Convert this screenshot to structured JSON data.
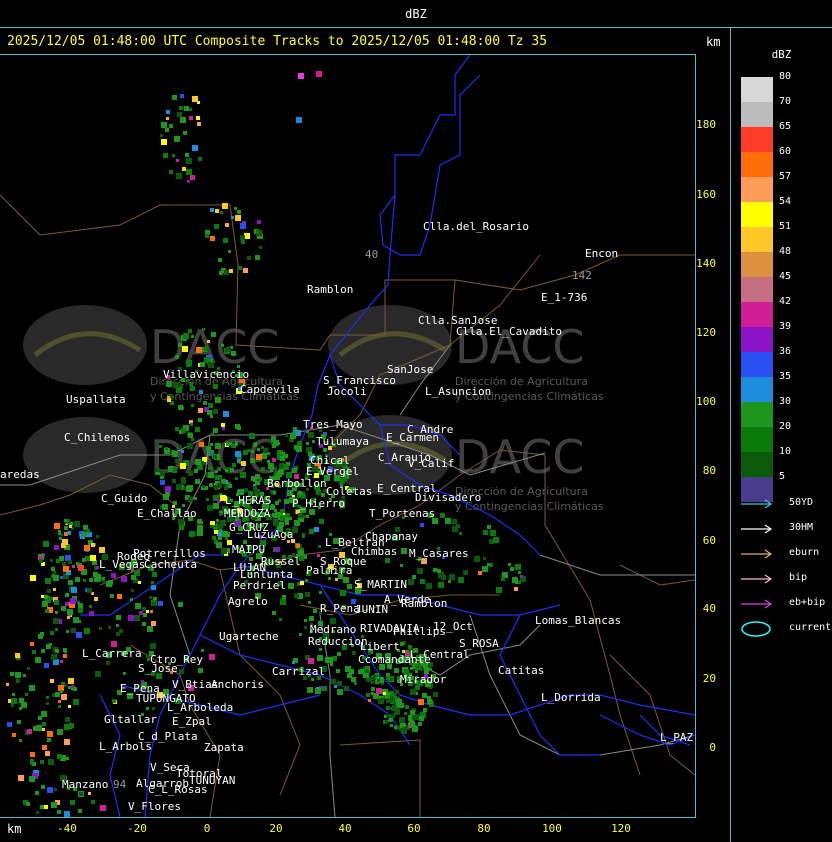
{
  "window": {
    "title": "dBZ"
  },
  "header": {
    "text": "2025/12/05 01:48:00 UTC Composite Tracks to 2025/12/05 01:48:00 Tz 35",
    "km_label": "km"
  },
  "axes": {
    "x_label": "km",
    "y_ticks": [
      "180",
      "160",
      "140",
      "120",
      "100",
      "80",
      "60",
      "40",
      "20",
      "0"
    ],
    "x_ticks": [
      "-40",
      "-20",
      "0",
      "20",
      "40",
      "60",
      "80",
      "100",
      "120"
    ]
  },
  "legend": {
    "title": "dBZ",
    "scale": [
      {
        "label": "80",
        "color": "#d8d8d8"
      },
      {
        "label": "70",
        "color": "#bcbcbc"
      },
      {
        "label": "65",
        "color": "#ff3c28"
      },
      {
        "label": "60",
        "color": "#ff6e0a"
      },
      {
        "label": "57",
        "color": "#ff9c5a"
      },
      {
        "label": "54",
        "color": "#ffff00"
      },
      {
        "label": "51",
        "color": "#ffc828"
      },
      {
        "label": "48",
        "color": "#dc9040"
      },
      {
        "label": "45",
        "color": "#c86e82"
      },
      {
        "label": "42",
        "color": "#d01e96"
      },
      {
        "label": "39",
        "color": "#8c14c8"
      },
      {
        "label": "36",
        "color": "#2850f0"
      },
      {
        "label": "35",
        "color": "#1e8cdc"
      },
      {
        "label": "30",
        "color": "#1e961e"
      },
      {
        "label": "20",
        "color": "#0a7a0a"
      },
      {
        "label": "10",
        "color": "#0a5a0a"
      },
      {
        "label": "5",
        "color": "#4a3c8c"
      }
    ],
    "tracks": [
      {
        "label": "50YD",
        "color": "#40c8d8",
        "kind": "arrow"
      },
      {
        "label": "30HM",
        "color": "#ffffff",
        "kind": "arrow"
      },
      {
        "label": "eburn",
        "color": "#e0b070",
        "kind": "arrow"
      },
      {
        "label": "bip",
        "color": "#ffb8d0",
        "kind": "arrow"
      },
      {
        "label": "eb+bip",
        "color": "#e040e0",
        "kind": "arrow"
      },
      {
        "label": "current",
        "color": "#30f0f0",
        "kind": "ellipse"
      }
    ]
  },
  "watermarks": [
    {
      "name": "DACC",
      "line1": "Dirección de Agricultura",
      "line2": "y Contingencias Climáticas"
    }
  ],
  "places": [
    {
      "name": "Clla.del_Rosario"
    },
    {
      "name": "Encon"
    },
    {
      "name": "142"
    },
    {
      "name": "E_1-736"
    },
    {
      "name": "Ramblon"
    },
    {
      "name": "40"
    },
    {
      "name": "Clla.SanJose"
    },
    {
      "name": "Clla.El_Cavadito"
    },
    {
      "name": "Villavicencio"
    },
    {
      "name": "Capdevila"
    },
    {
      "name": "S_Francisco"
    },
    {
      "name": "Jocoli"
    },
    {
      "name": "SanJose"
    },
    {
      "name": "L_Asuncion"
    },
    {
      "name": "Uspallata"
    },
    {
      "name": "Tres_Mayo"
    },
    {
      "name": "C_Andre"
    },
    {
      "name": "C_Chilenos"
    },
    {
      "name": "Tulumaya"
    },
    {
      "name": "E_Carmen"
    },
    {
      "name": "C_Araujo"
    },
    {
      "name": "V_Calif"
    },
    {
      "name": "aredas"
    },
    {
      "name": "Chical"
    },
    {
      "name": "E_Vergel"
    },
    {
      "name": "Borbollon"
    },
    {
      "name": "Coletas"
    },
    {
      "name": "E_Central"
    },
    {
      "name": "Divisadero"
    },
    {
      "name": "C_Guido"
    },
    {
      "name": "L_HERAS"
    },
    {
      "name": "P_Hierro"
    },
    {
      "name": "E_Challao"
    },
    {
      "name": "MENDOZA"
    },
    {
      "name": "T_Portenas"
    },
    {
      "name": "G_CRUZ"
    },
    {
      "name": "LuzuAga"
    },
    {
      "name": "Chapanay"
    },
    {
      "name": "MAIPU"
    },
    {
      "name": "L_Beltran"
    },
    {
      "name": "Chimbas"
    },
    {
      "name": "M_Casares"
    },
    {
      "name": "Potrerillos"
    },
    {
      "name": "Rodeo"
    },
    {
      "name": "L_Vegas"
    },
    {
      "name": "Cacheuta"
    },
    {
      "name": "Russel"
    },
    {
      "name": "S_Roque"
    },
    {
      "name": "LUJAN"
    },
    {
      "name": "Palmira"
    },
    {
      "name": "Lunlunta"
    },
    {
      "name": "Perdriel"
    },
    {
      "name": "S_MARTIN"
    },
    {
      "name": "A_Verde"
    },
    {
      "name": "Ramblon"
    },
    {
      "name": "Agrelo"
    },
    {
      "name": "R_Pena"
    },
    {
      "name": "JUNIN"
    },
    {
      "name": "Lomas_Blancas"
    },
    {
      "name": "12_Oct"
    },
    {
      "name": "Ugarteche"
    },
    {
      "name": "Medrano"
    },
    {
      "name": "RIVADAVIA"
    },
    {
      "name": "Phillips"
    },
    {
      "name": "Reduccion"
    },
    {
      "name": "L_Carrera"
    },
    {
      "name": "Ctro_Rey"
    },
    {
      "name": "S_ROSA"
    },
    {
      "name": "Libert"
    },
    {
      "name": "L_Central"
    },
    {
      "name": "S_Jose"
    },
    {
      "name": "Carrizal"
    },
    {
      "name": "Ccomandante"
    },
    {
      "name": "Catitas"
    },
    {
      "name": "Mirador"
    },
    {
      "name": "Anchoris"
    },
    {
      "name": "E_Pena"
    },
    {
      "name": "V_Btias"
    },
    {
      "name": "TUPUNGATO"
    },
    {
      "name": "L_Dorrida"
    },
    {
      "name": "L_Arboleda"
    },
    {
      "name": "E_Zpal"
    },
    {
      "name": "Gltallar"
    },
    {
      "name": "C_d_Plata"
    },
    {
      "name": "L_Arbols"
    },
    {
      "name": "Zapata"
    },
    {
      "name": "L_PAZ"
    },
    {
      "name": "Algarrob"
    },
    {
      "name": "V_Seca"
    },
    {
      "name": "Totoral"
    },
    {
      "name": "Manzano"
    },
    {
      "name": "TUNUYAN"
    },
    {
      "name": "C_L_Rosas"
    },
    {
      "name": "V_Flores"
    },
    {
      "name": "94"
    }
  ]
}
